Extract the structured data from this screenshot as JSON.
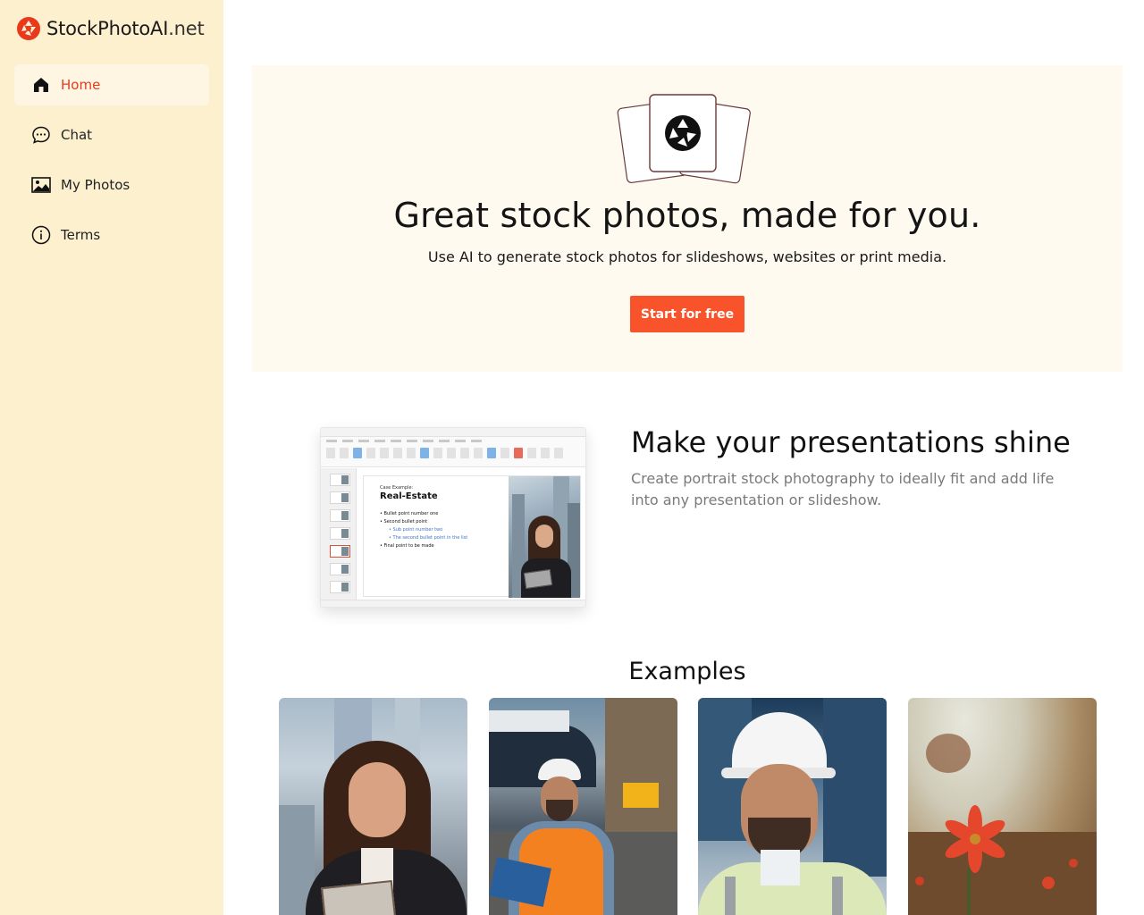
{
  "brand": {
    "name": "StockPhotoAI",
    "tld": ".net",
    "accent": "#e8391c"
  },
  "sidebar": {
    "items": [
      {
        "label": "Home",
        "icon": "home-icon",
        "active": true
      },
      {
        "label": "Chat",
        "icon": "chat-bubble-icon",
        "active": false
      },
      {
        "label": "My Photos",
        "icon": "image-icon",
        "active": false
      },
      {
        "label": "Terms",
        "icon": "info-icon",
        "active": false
      }
    ]
  },
  "hero": {
    "title": "Great stock photos, made for you.",
    "subtitle": "Use AI to generate stock photos for slideshows, websites or print media.",
    "cta_label": "Start for free",
    "cta_color": "#f8532b"
  },
  "feature": {
    "title": "Make your presentations shine",
    "description": "Create portrait stock photography to ideally fit and add life into any presentation or slideshow.",
    "slide": {
      "kicker": "Case Example:",
      "heading": "Real-Estate",
      "bullets": [
        {
          "text": "• Bullet point number one",
          "level": 0
        },
        {
          "text": "• Second bullet point",
          "level": 0
        },
        {
          "text": "• Sub point number two",
          "level": 1
        },
        {
          "text": "• The second bullet point in the list",
          "level": 1
        },
        {
          "text": "• Final point to be made",
          "level": 0
        }
      ]
    }
  },
  "examples": {
    "title": "Examples",
    "items": [
      {
        "subject": "businesswoman-with-tablet"
      },
      {
        "subject": "port-worker-with-clipboard"
      },
      {
        "subject": "smiling-engineer-hard-hat"
      },
      {
        "subject": "red-flower-field"
      }
    ]
  }
}
